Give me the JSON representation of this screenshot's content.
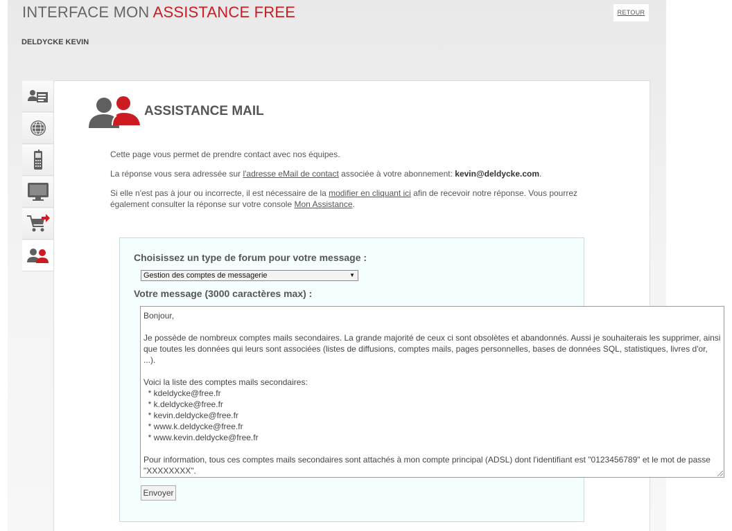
{
  "header": {
    "title_prefix": "INTERFACE MON",
    "title_brand": "ASSISTANCE FREE",
    "back_label": "RETOUR",
    "user_name": "DELDYCKE KEVIN"
  },
  "nav": {
    "items": [
      {
        "icon": "contact-card-icon"
      },
      {
        "icon": "globe-icon"
      },
      {
        "icon": "mobile-phone-icon"
      },
      {
        "icon": "monitor-icon"
      },
      {
        "icon": "cart-icon"
      },
      {
        "icon": "assistance-users-icon"
      }
    ],
    "active_index": 5
  },
  "page": {
    "title": "ASSISTANCE MAIL",
    "intro": "Cette page vous permet de prendre contact avec nos équipes.",
    "reply_prefix": "La réponse vous sera adressée sur ",
    "reply_link": "l'adresse eMail de contact",
    "reply_middle": " associée à votre abonnement: ",
    "reply_email": "kevin@deldycke.com",
    "reply_suffix": ".",
    "update_prefix": "Si elle n'est pas à jour ou incorrecte, il est nécessaire de la ",
    "update_link": "modifier en cliquant ici",
    "update_middle": " afin de recevoir notre réponse. Vous pourrez également consulter la réponse sur votre console ",
    "update_link2": "Mon Assistance",
    "update_suffix": "."
  },
  "form": {
    "forum_label": "Choisissez un type de forum pour votre message :",
    "forum_selected": "Gestion des comptes de messagerie",
    "message_label": "Votre message (3000 caractères max) :",
    "message_lines": [
      "Bonjour,",
      "",
      "Je possède de nombreux comptes mails secondaires. La grande majorité de ceux ci sont obsolètes et abandonnés. Aussi je souhaiterais les supprimer, ainsi que toutes les données qui leurs sont associées (listes de diffusions, comptes mails, pages personnelles, bases de données SQL, statistiques, livres d'or, ...).",
      "",
      "Voici la liste des comptes mails secondaires:",
      "  * kdeldycke@free.fr",
      "  * k.deldycke@free.fr",
      "  * kevin.deldycke@free.fr",
      "  * www.k.deldycke@free.fr",
      "  * www.kevin.deldycke@free.fr",
      "",
      "Pour information, tous ces comptes mails secondaires sont attachés à mon compte principal (ADSL) dont l'identifiant est \"0123456789\" et le mot de passe \"XXXXXXXX\"."
    ],
    "send_label": "Envoyer"
  },
  "colors": {
    "brand": "#cc1c22",
    "form_bg": "#f4fefe",
    "icon_gray": "#5f5f5f"
  }
}
